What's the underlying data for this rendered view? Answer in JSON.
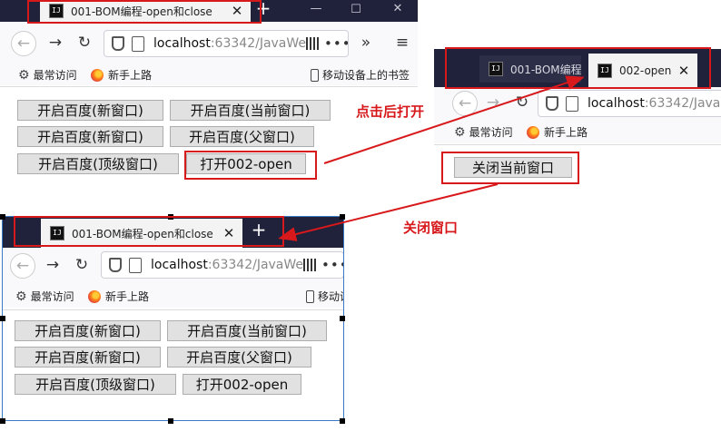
{
  "colors": {
    "tabbar": "#20213a",
    "annotation": "#d7191c",
    "button_bg": "#e1e1e1"
  },
  "window1": {
    "tab_title": "001-BOM编程-open和close",
    "new_tab": "+",
    "url_host": "localhost",
    "url_rest": ":63342/JavaWe",
    "bookmarks": [
      "最常访问",
      "新手上路"
    ],
    "mobile_bookmarks": "移动设备上的书签",
    "buttons": [
      "开启百度(新窗口)",
      "开启百度(当前窗口)",
      "开启百度(新窗口)",
      "开启百度(父窗口)",
      "开启百度(顶级窗口)",
      "打开002-open"
    ]
  },
  "window2": {
    "tab1_title": "001-BOM编程",
    "tab2_title": "002-open",
    "url_host": "localhost",
    "url_rest": ":63342/JavaW",
    "bookmarks": [
      "最常访问",
      "新手上路"
    ],
    "button": "关闭当前窗口"
  },
  "window3": {
    "tab_title": "001-BOM编程-open和close",
    "new_tab": "+",
    "url_host": "localhost",
    "url_rest": ":63342/JavaWe",
    "bookmarks": [
      "最常访问",
      "新手上路"
    ],
    "mobile_bookmarks": "移动设",
    "buttons": [
      "开启百度(新窗口)",
      "开启百度(当前窗口)",
      "开启百度(新窗口)",
      "开启百度(父窗口)",
      "开启百度(顶级窗口)",
      "打开002-open"
    ]
  },
  "annotations": {
    "after_click": "点击后打开",
    "close_window": "关闭窗口"
  }
}
